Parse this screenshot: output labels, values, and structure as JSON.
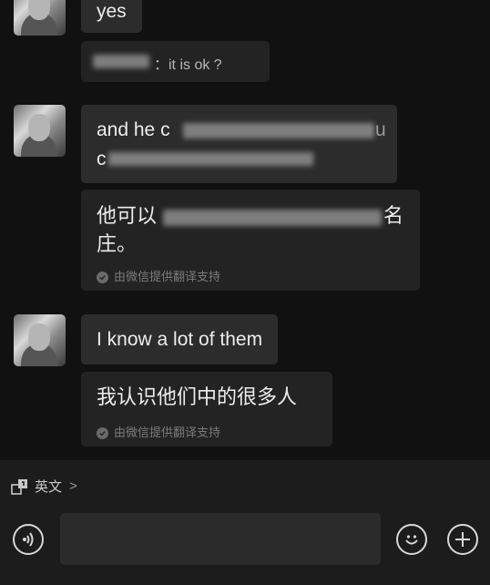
{
  "messages": [
    {
      "text": "yes"
    },
    {
      "quote_suffix": "：it is ok ?"
    },
    {
      "text_line1": "and he c",
      "text_line2": "c"
    },
    {
      "translation_line1": "他可以",
      "translation_line2_start": "",
      "translation_line1_end": "名",
      "translation_line2": "庄。",
      "note": "由微信提供翻译支持"
    },
    {
      "text": "I know a lot of them"
    },
    {
      "translation": "我认识他们中的很多人",
      "note": "由微信提供翻译支持"
    }
  ],
  "bottom": {
    "language_label": "英文",
    "voice_icon": "voice-icon",
    "emoji_icon": "emoji-icon",
    "add_icon": "add-icon"
  }
}
